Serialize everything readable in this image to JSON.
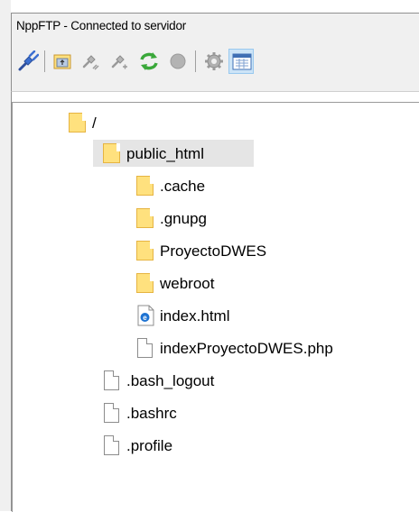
{
  "window": {
    "title": "NppFTP - Connected to servidor"
  },
  "toolbar": {
    "buttons": [
      {
        "icon": "connect-icon",
        "label": ""
      },
      {
        "icon": "upload-icon",
        "label": ""
      },
      {
        "icon": "download-icon",
        "label": ""
      },
      {
        "icon": "download-alt-icon",
        "label": ""
      },
      {
        "icon": "refresh-icon",
        "label": ""
      },
      {
        "icon": "abort-icon",
        "label": ""
      },
      {
        "icon": "settings-icon",
        "label": ""
      },
      {
        "icon": "message-window-icon",
        "label": ""
      }
    ]
  },
  "tree": {
    "items": [
      {
        "label": "/",
        "type": "folder",
        "depth": 0
      },
      {
        "label": "public_html",
        "type": "folder",
        "depth": 1,
        "selected": true
      },
      {
        "label": ".cache",
        "type": "folder",
        "depth": 2
      },
      {
        "label": ".gnupg",
        "type": "folder",
        "depth": 2
      },
      {
        "label": "ProyectoDWES",
        "type": "folder",
        "depth": 2
      },
      {
        "label": "webroot",
        "type": "folder",
        "depth": 2
      },
      {
        "label": "index.html",
        "type": "html-file",
        "depth": 2
      },
      {
        "label": "indexProyectoDWES.php",
        "type": "file",
        "depth": 2
      },
      {
        "label": ".bash_logout",
        "type": "file",
        "depth": 1
      },
      {
        "label": ".bashrc",
        "type": "file",
        "depth": 1
      },
      {
        "label": ".profile",
        "type": "file",
        "depth": 1
      }
    ]
  },
  "colors": {
    "folder": "#ffe17e",
    "selection": "#e5e5e5",
    "refresh_green": "#3aa83a",
    "toolbar_bg": "#f0f0f0"
  }
}
